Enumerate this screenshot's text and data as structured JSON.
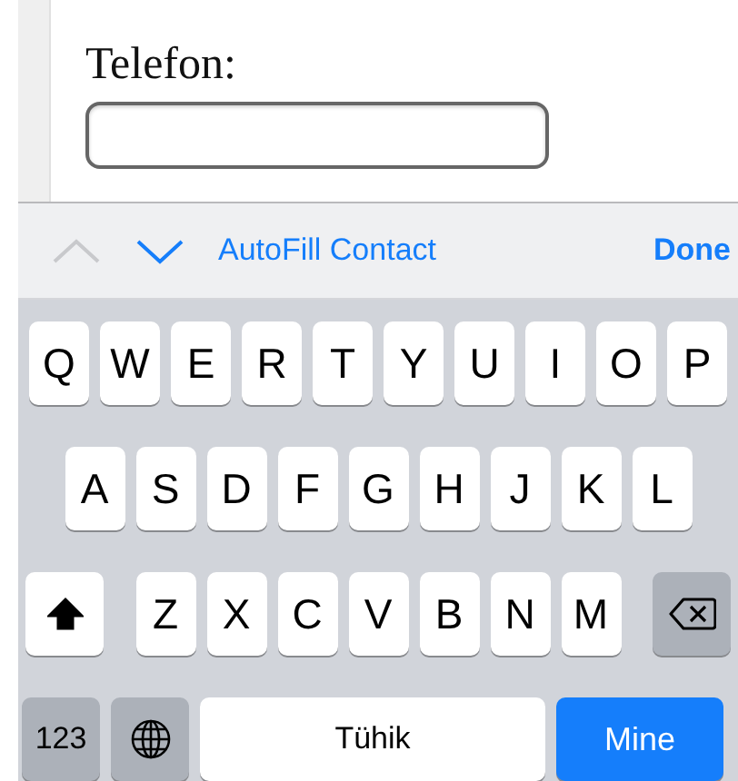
{
  "form": {
    "label": "Telefon:"
  },
  "accessory_bar": {
    "previous": {
      "disabled": true
    },
    "next": {
      "disabled": false
    },
    "autofill": "AutoFill Contact",
    "done": "Done"
  },
  "keyboard": {
    "rows": [
      {
        "keys": [
          {
            "kind": "letter",
            "label": "Q"
          },
          {
            "kind": "letter",
            "label": "W"
          },
          {
            "kind": "letter",
            "label": "E"
          },
          {
            "kind": "letter",
            "label": "R"
          },
          {
            "kind": "letter",
            "label": "T"
          },
          {
            "kind": "letter",
            "label": "Y"
          },
          {
            "kind": "letter",
            "label": "U"
          },
          {
            "kind": "letter",
            "label": "I"
          },
          {
            "kind": "letter",
            "label": "O"
          },
          {
            "kind": "letter",
            "label": "P"
          }
        ]
      },
      {
        "keys": [
          {
            "kind": "letter",
            "label": "A"
          },
          {
            "kind": "letter",
            "label": "S"
          },
          {
            "kind": "letter",
            "label": "D"
          },
          {
            "kind": "letter",
            "label": "F"
          },
          {
            "kind": "letter",
            "label": "G"
          },
          {
            "kind": "letter",
            "label": "H"
          },
          {
            "kind": "letter",
            "label": "J"
          },
          {
            "kind": "letter",
            "label": "K"
          },
          {
            "kind": "letter",
            "label": "L"
          }
        ]
      },
      {
        "keys": [
          {
            "kind": "shift",
            "on": true
          },
          {
            "kind": "letter",
            "label": "Z"
          },
          {
            "kind": "letter",
            "label": "X"
          },
          {
            "kind": "letter",
            "label": "C"
          },
          {
            "kind": "letter",
            "label": "V"
          },
          {
            "kind": "letter",
            "label": "B"
          },
          {
            "kind": "letter",
            "label": "N"
          },
          {
            "kind": "letter",
            "label": "M"
          },
          {
            "kind": "backspace"
          }
        ]
      },
      {
        "keys": [
          {
            "kind": "numbers",
            "label": "123"
          },
          {
            "kind": "globe"
          },
          {
            "kind": "space",
            "label": "Tühik"
          },
          {
            "kind": "return",
            "label": "Mine"
          }
        ]
      }
    ]
  }
}
